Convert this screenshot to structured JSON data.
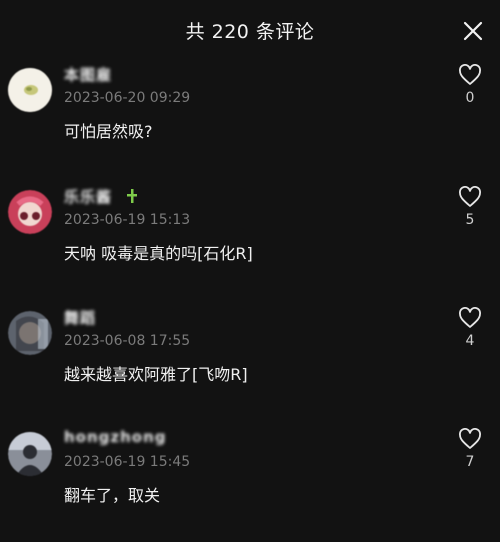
{
  "header": {
    "title": "共 220 条评论"
  },
  "comments": [
    {
      "username": "本图雇",
      "timestamp": "2023-06-20 09:29",
      "text": "可怕居然吸?",
      "likes": "0",
      "avatar_color": "#f3f0e6"
    },
    {
      "username": "乐乐酱",
      "timestamp": "2023-06-19 15:13",
      "text": "天呐 吸毒是真的吗[石化R]",
      "likes": "5",
      "avatar_color": "#c9405a"
    },
    {
      "username": "舞蹈",
      "timestamp": "2023-06-08 17:55",
      "text": "越来越喜欢阿雅了[飞吻R]",
      "likes": "4",
      "avatar_color": "#6a6f78"
    },
    {
      "username": "hongzhong",
      "timestamp": "2023-06-19 15:45",
      "text": "翻车了，取关",
      "likes": "7",
      "avatar_color": "#3a3d44"
    }
  ]
}
